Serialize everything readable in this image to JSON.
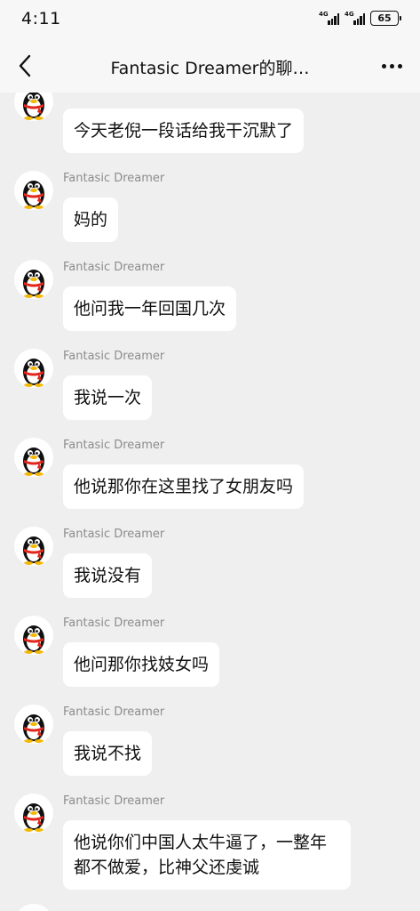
{
  "status_bar": {
    "time": "4:11",
    "network_1": "4G",
    "network_2": "4G",
    "battery": "65"
  },
  "header": {
    "title": "Fantasic Dreamer的聊…",
    "back_icon": "chevron-left-icon",
    "more_icon": "more-dots-icon"
  },
  "avatar": {
    "icon": "qq-penguin-icon",
    "colors": {
      "body": "#111111",
      "belly": "#ffffff",
      "beak": "#f5b800",
      "scarf": "#e3261b"
    }
  },
  "messages": [
    {
      "sender": "Fantasic Dreamer",
      "text": "今天老倪一段话给我干沉默了"
    },
    {
      "sender": "Fantasic Dreamer",
      "text": "妈的"
    },
    {
      "sender": "Fantasic Dreamer",
      "text": "他问我一年回国几次"
    },
    {
      "sender": "Fantasic Dreamer",
      "text": "我说一次"
    },
    {
      "sender": "Fantasic Dreamer",
      "text": "他说那你在这里找了女朋友吗"
    },
    {
      "sender": "Fantasic Dreamer",
      "text": "我说没有"
    },
    {
      "sender": "Fantasic Dreamer",
      "text": "他问那你找妓女吗"
    },
    {
      "sender": "Fantasic Dreamer",
      "text": "我说不找"
    },
    {
      "sender": "Fantasic Dreamer",
      "text": "他说你们中国人太牛逼了，一整年都不做爱，比神父还虔诚"
    }
  ]
}
